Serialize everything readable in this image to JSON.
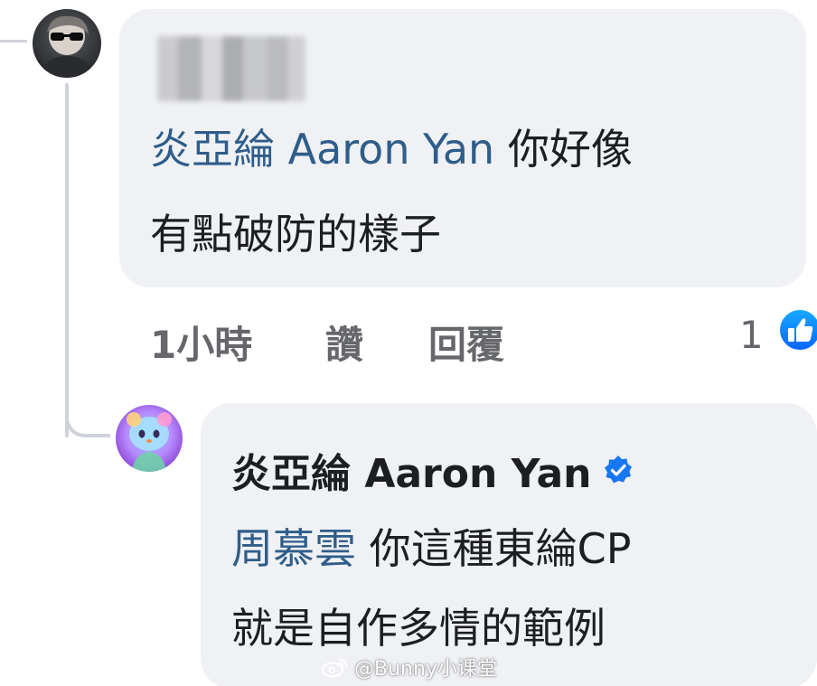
{
  "comment_1": {
    "author_blurred": true,
    "mention": "炎亞綸 Aaron Yan",
    "text_line_1_rest": " 你好像",
    "text_line_2": "有點破防的樣子",
    "actions": {
      "time": "1小時",
      "like": "讚",
      "reply": "回覆"
    },
    "reaction_count": "1"
  },
  "reply_1": {
    "author": "炎亞綸 Aaron Yan",
    "verified": true,
    "mention": "周慕雲",
    "text_line_1_rest": " 你這種東綸CP",
    "text_line_2": "就是自作多情的範例"
  },
  "watermark": {
    "text": "@Bunny小课堂"
  },
  "colors": {
    "bubble_bg": "#eff1f4",
    "mention": "#2f5d8a",
    "text": "#1c1e21",
    "muted": "#65676b",
    "like_blue": "#0866ff"
  }
}
